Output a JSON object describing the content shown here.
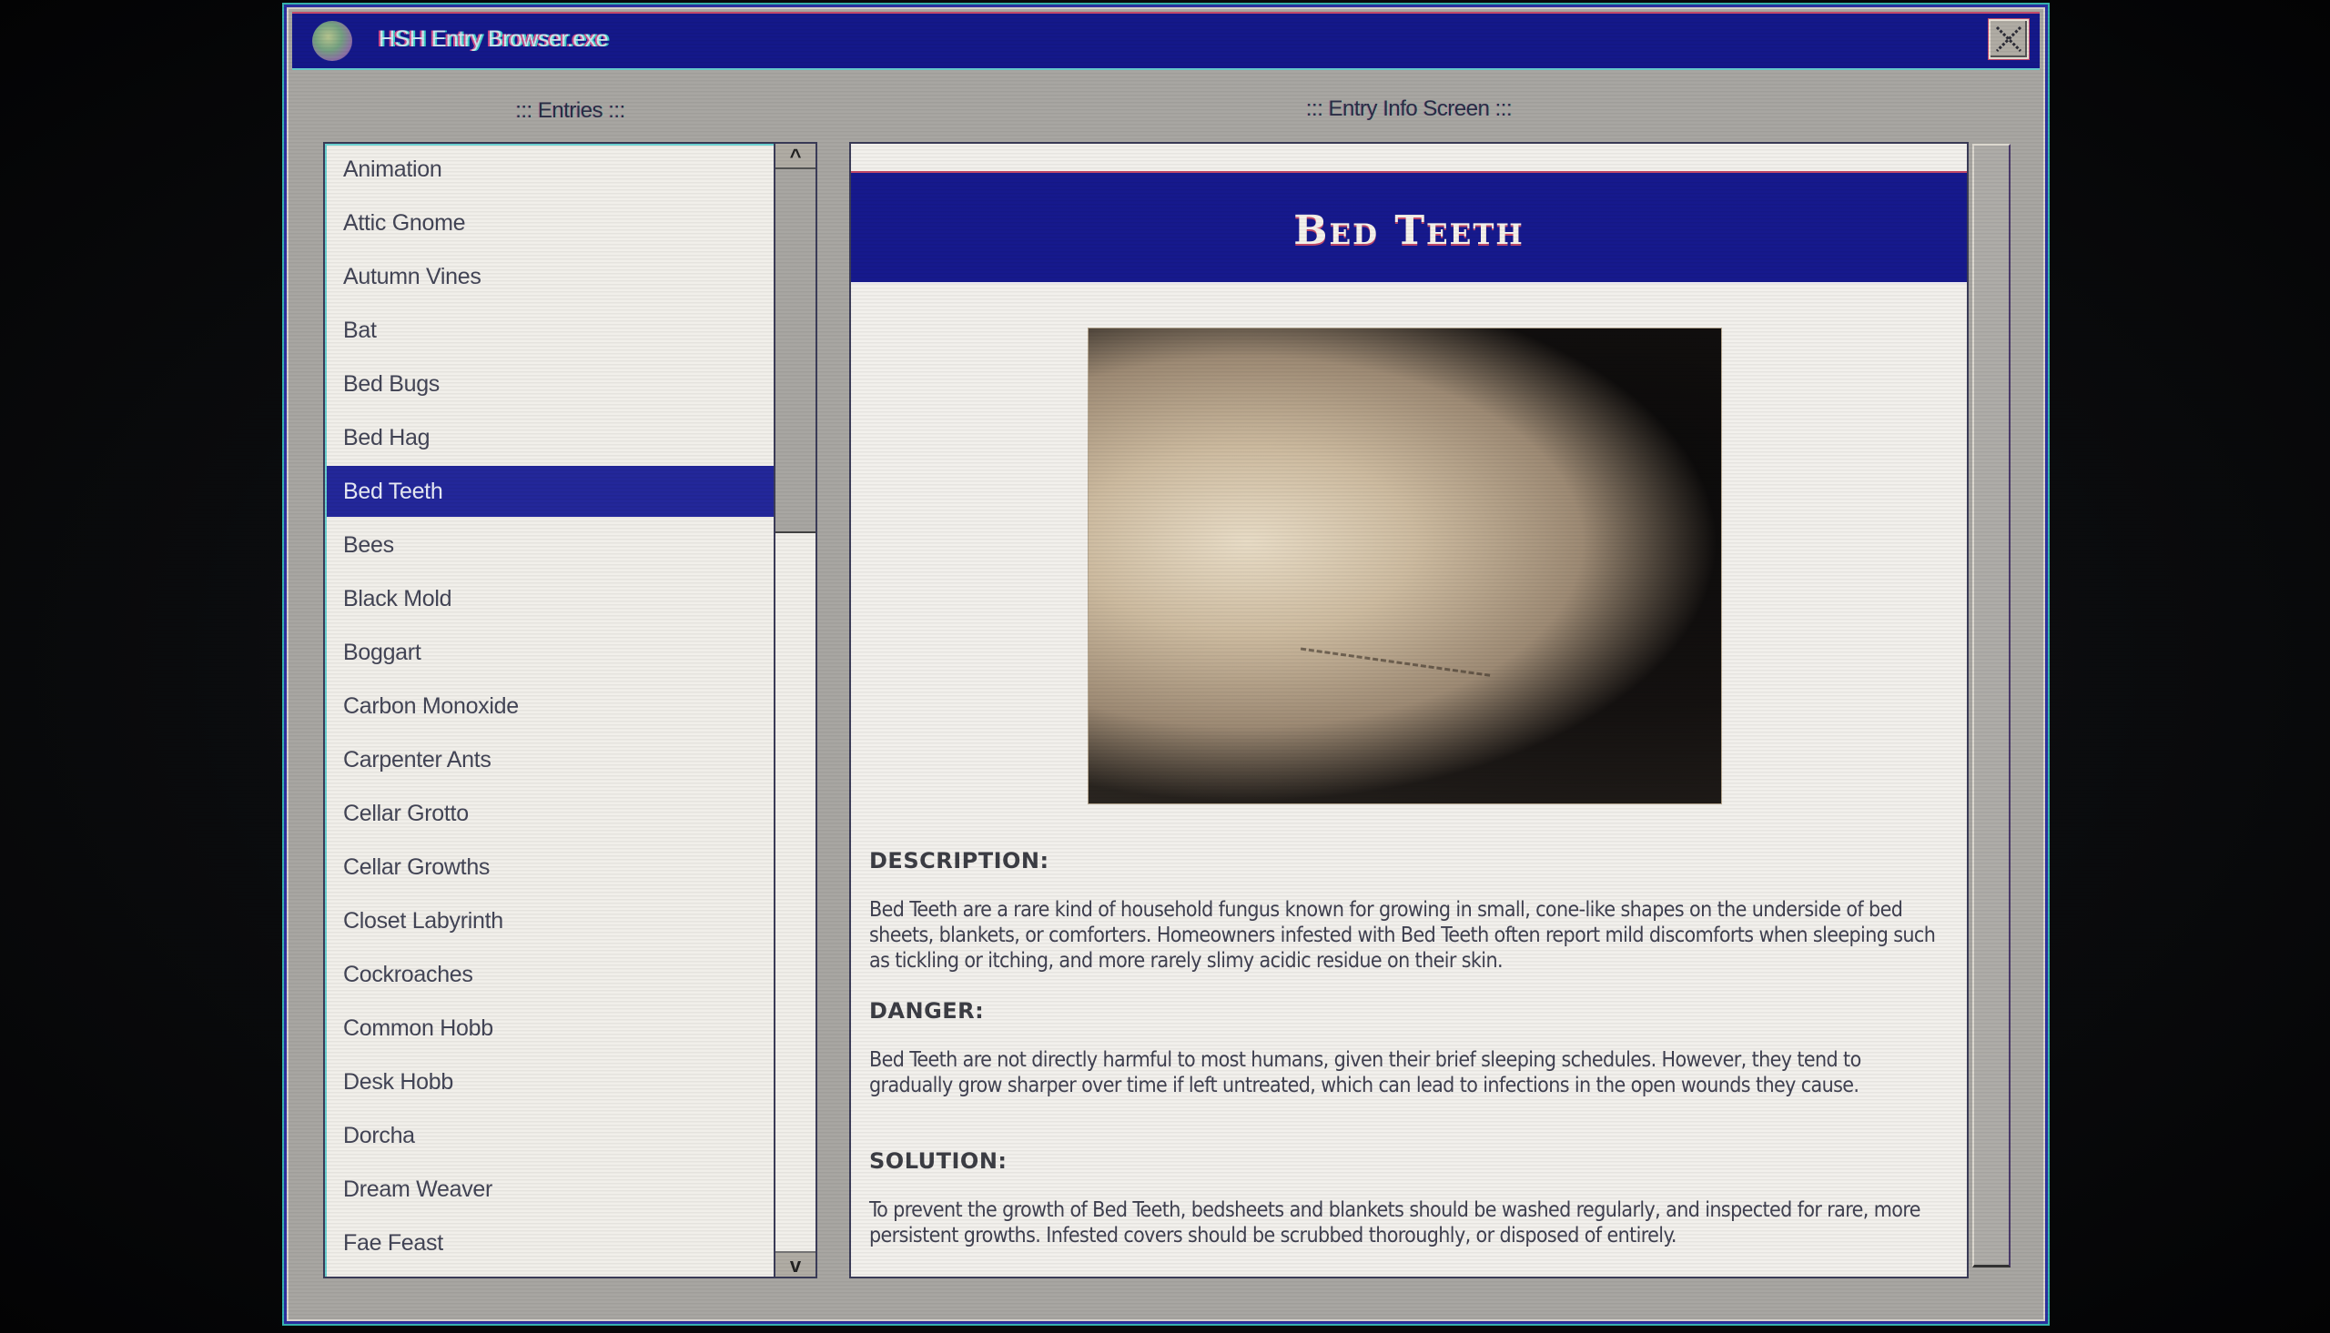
{
  "window": {
    "title": "HSH Entry Browser.exe",
    "icon": "brain-globe-icon",
    "close_icon": "close-x-icon"
  },
  "entries_panel": {
    "label": "::: Entries :::",
    "items": [
      "Animation",
      "Attic Gnome",
      "Autumn Vines",
      "Bat",
      "Bed Bugs",
      "Bed Hag",
      "Bed Teeth",
      "Bees",
      "Black Mold",
      "Boggart",
      "Carbon Monoxide",
      "Carpenter Ants",
      "Cellar Grotto",
      "Cellar Growths",
      "Closet Labyrinth",
      "Cockroaches",
      "Common Hobb",
      "Desk Hobb",
      "Dorcha",
      "Dream Weaver",
      "Fae Feast"
    ],
    "selected": "Bed Teeth",
    "scroll_up_label": "^",
    "scroll_down_label": "v"
  },
  "info_panel": {
    "label": "::: Entry Info Screen :::",
    "entry_title": "Bed Teeth",
    "image_alt": "Photo of rumpled bedsheets with a row of small teeth-like growths",
    "sections": {
      "description": {
        "heading": "DESCRIPTION:",
        "body": "Bed Teeth are a rare kind of household fungus known for growing in small, cone-like shapes on the underside of bed sheets, blankets, or comforters. Homeowners infested with Bed Teeth often report mild discomforts when sleeping such as tickling or itching, and more rarely slimy acidic residue on their skin."
      },
      "danger": {
        "heading": "DANGER:",
        "body": "Bed Teeth are not directly harmful to most humans, given their brief sleeping schedules. However, they tend to gradually grow sharper over time if left untreated, which can lead to infections in the open wounds they cause."
      },
      "solution": {
        "heading": "SOLUTION:",
        "body": "To prevent the growth of Bed Teeth, bedsheets and blankets should be washed regularly, and inspected for rare, more persistent growths. Infested covers should be scrubbed thoroughly, or disposed of entirely."
      }
    }
  },
  "colors": {
    "titlebar": "#14188a",
    "selection": "#23279a",
    "window_face": "#a8a6a2",
    "panel_bg": "#f1efea"
  }
}
